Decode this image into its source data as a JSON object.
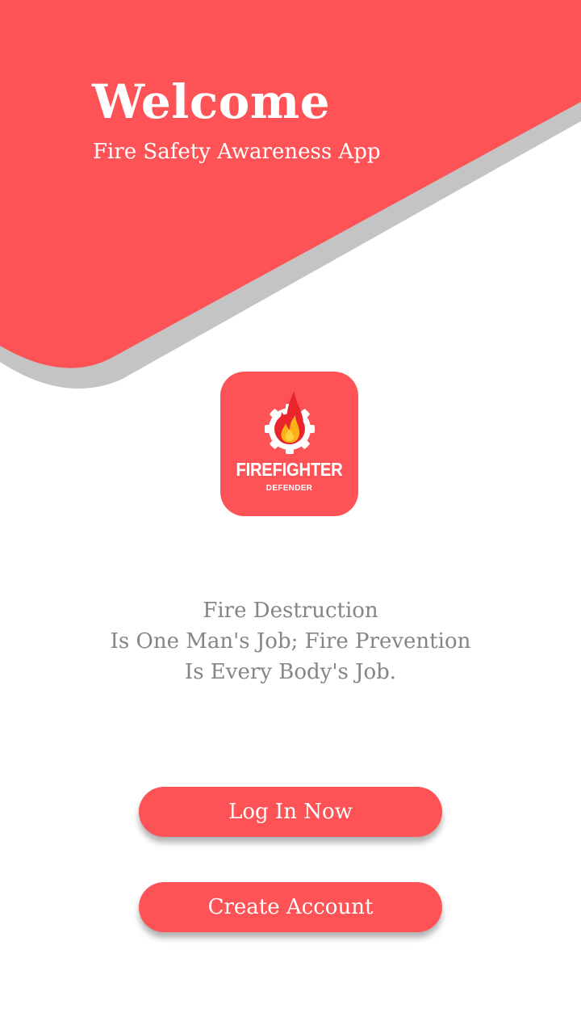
{
  "header": {
    "title": "Welcome",
    "subtitle": "Fire Safety Awareness App"
  },
  "logo": {
    "icon": "flame-gear-icon",
    "name": "FIREFIGHTER",
    "tagline": "DEFENDER"
  },
  "quote": {
    "lines": [
      "Fire Destruction",
      "Is One Man's Job; Fire Prevention",
      "Is Every Body's Job."
    ]
  },
  "actions": {
    "login_label": "Log In Now",
    "create_label": "Create Account"
  },
  "colors": {
    "accent": "#fd5356",
    "shadow": "#c4c4c4",
    "quote_text": "#858585",
    "flame_outer": "#e8262b",
    "flame_inner": "#fcb116"
  }
}
